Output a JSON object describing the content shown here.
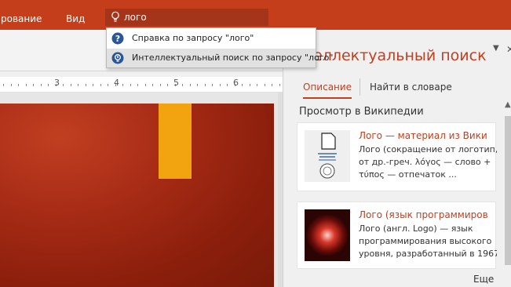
{
  "ribbon": {
    "tab_review_partial": "рование",
    "tab_view": "Вид",
    "tell_me_value": "лого"
  },
  "dropdown": {
    "items": [
      {
        "label": "Справка по запросу \"лого\"",
        "icon": "help-icon"
      },
      {
        "label": "Интеллектуальный поиск по запросу \"лого\"",
        "icon": "smart-lookup-icon"
      }
    ]
  },
  "ruler": {
    "labels": [
      "3",
      "4",
      "5",
      "6"
    ]
  },
  "pane": {
    "title_partial": "еллектуальный поиск",
    "tabs": {
      "description": "Описание",
      "dictionary": "Найти в словаре"
    },
    "section_heading": "Просмотр в Википедии",
    "results": [
      {
        "title": "Лого — материал из Вики",
        "lines": [
          "Лого (сокращение от логотип,",
          "от др.-греч. λόγος — слово +",
          "τύπος — отпечаток  ..."
        ]
      },
      {
        "title": "Лого (язык программиров",
        "lines": [
          "Лого (англ. Logo) — язык",
          "программирования высокого",
          "уровня, разработанный в 1967"
        ]
      }
    ],
    "more": "Еще"
  },
  "colors": {
    "accent": "#c43e1c",
    "tell_me_bg": "#a5351a",
    "slide_shape": "#f1a40f"
  }
}
